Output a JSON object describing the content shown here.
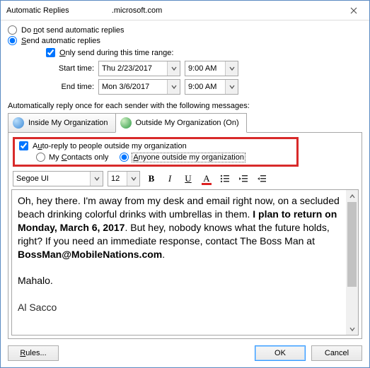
{
  "title": "Automatic Replies",
  "title_domain": ".microsoft.com",
  "radios": {
    "dont_send": "Do not send automatic replies",
    "send": "Send automatic replies"
  },
  "only_send_range": "Only send during this time range:",
  "start_label": "Start time:",
  "end_label": "End time:",
  "start_date": "Thu 2/23/2017",
  "start_time": "9:00 AM",
  "end_date": "Mon 3/6/2017",
  "end_time": "9:00 AM",
  "auto_reply_once": "Automatically reply once for each sender with the following messages:",
  "tabs": {
    "inside": "Inside My Organization",
    "outside": "Outside My Organization (On)"
  },
  "outside_opts": {
    "autoreply_cb": "Auto-reply to people outside my organization",
    "contacts_only": "My Contacts only",
    "anyone": "Anyone outside my organization"
  },
  "font": {
    "name": "Segoe UI",
    "size": "12"
  },
  "toolbar": {
    "bold": "B",
    "italic": "I",
    "underline": "U",
    "fontcolor": "A"
  },
  "message": {
    "p1a": "Oh, hey there. I'm away from my desk and email right now, on a secluded beach drinking colorful drinks with umbrellas in them. ",
    "p1b": "I plan to return on Monday, March 6, 2017",
    "p1c": ". But hey, nobody knows what the future holds, right? If you need an immediate response, contact The Boss Man at ",
    "p1d": "BossMan@MobileNations.com",
    "p1e": ".",
    "p2": "Mahalo.",
    "p3": "Al Sacco"
  },
  "buttons": {
    "rules": "Rules...",
    "ok": "OK",
    "cancel": "Cancel"
  }
}
